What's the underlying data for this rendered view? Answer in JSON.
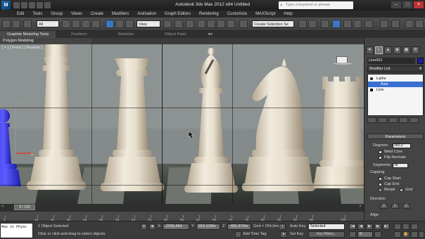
{
  "window": {
    "title": "Autodesk 3ds Max 2012 x64      Untitled",
    "search_placeholder": "Type a keyword or phrase",
    "app_icon_letter": "M"
  },
  "menu": [
    "Edit",
    "Tools",
    "Group",
    "Views",
    "Create",
    "Modifiers",
    "Animation",
    "Graph Editors",
    "Rendering",
    "Customize",
    "MAXScript",
    "Help"
  ],
  "toolbar": {
    "filter_value": "All",
    "view_value": "View",
    "selection_set_placeholder": "Create Selection Se"
  },
  "ribbon": {
    "tabs": [
      "Graphite Modeling Tools",
      "Freeform",
      "Selection",
      "Object Paint"
    ],
    "active_tab": "Graphite Modeling Tools",
    "sub_tab": "Polygon Modeling"
  },
  "viewport": {
    "label": "[ + ] [ Front ] [ Realistic ]"
  },
  "timeline": {
    "slider_text": "0 / 100",
    "ticks": [
      "0",
      "10",
      "15",
      "20",
      "25",
      "30",
      "35",
      "40",
      "45",
      "50",
      "55",
      "60",
      "65",
      "70",
      "75",
      "80",
      "85",
      "90",
      "95",
      "100"
    ]
  },
  "status": {
    "maxscript_lines": [
      "Max to Physc",
      ""
    ],
    "selected": "1 Object Selected",
    "prompt": "Click or click-and-drag to select objects",
    "x_label": "X:",
    "x_value": "-2255,454",
    "y_label": "Y:",
    "y_value": "916,139m",
    "z_label": "Z:",
    "z_value": "-491,972m",
    "grid": "Grid = 254,0mm",
    "add_time_tag": "Add Time Tag",
    "auto_key": "Auto Key",
    "set_key": "Set Key",
    "selected_dropdown": "Selected",
    "key_filters": "Key Filters...",
    "frame": "0"
  },
  "panel": {
    "object_name": "Line001",
    "object_color": "#1d1d9e",
    "modifier_list": "Modifier List",
    "stack": [
      {
        "label": "Lathe",
        "selected": false
      },
      {
        "label": "Axis",
        "selected": true
      },
      {
        "label": "Line",
        "selected": false
      }
    ],
    "parameters_title": "Parameters",
    "degrees_label": "Degrees:",
    "degrees_value": "360,0",
    "weld_core": "Weld Core",
    "flip_normals": "Flip Normals",
    "segments_label": "Segments:",
    "segments_value": "58",
    "capping_label": "Capping",
    "cap_start": "Cap Start",
    "cap_end": "Cap End",
    "morph": "Morph",
    "grid_opt": "Grid",
    "direction_label": "Direction",
    "dir_x": "X",
    "dir_y": "Y",
    "dir_z": "Z",
    "align_label": "Align"
  }
}
